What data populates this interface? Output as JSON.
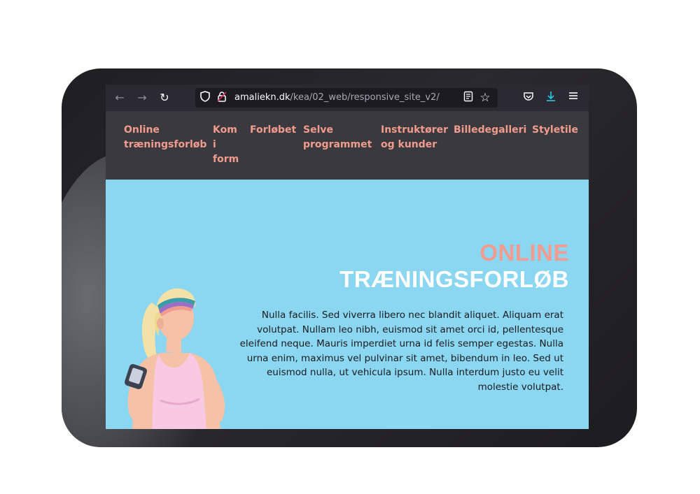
{
  "browser": {
    "url_domain": "amaliekn.dk",
    "url_path": "/kea/02_web/responsive_site_v2/",
    "icons": {
      "back": "arrow-left-icon",
      "forward": "arrow-right-icon",
      "reload": "reload-icon",
      "shield": "tracking-shield-icon",
      "lock": "insecure-lock-icon",
      "reader": "reader-view-icon",
      "bookmark": "star-icon",
      "pocket": "pocket-icon",
      "downloads": "download-icon",
      "menu": "hamburger-menu-icon"
    }
  },
  "site_nav": {
    "items": [
      {
        "label": "Online\ntræningsforløb"
      },
      {
        "label": "Kom\ni\nform"
      },
      {
        "label": "Forløbet"
      },
      {
        "label": "Selve\nprogrammet"
      },
      {
        "label": "Instruktører\nog kunder"
      },
      {
        "label": "Billedegalleri"
      },
      {
        "label": "Styletile"
      }
    ]
  },
  "hero": {
    "title_line1": "ONLINE",
    "title_line2": "TRÆNINGSFORLØB",
    "body": "Nulla facilis. Sed viverra libero nec blandit aliquet. Aliquam erat volutpat. Nullam leo nibh, euismod sit amet orci id, pellentesque eleifend neque. Mauris imperdiet urna id felis semper egestas. Nulla urna enim, maximus vel pulvinar sit amet, bibendum in leo. Sed ut euismod nulla, ut vehicula ipsum. Nulla interdum justo eu velit molestie volutpat."
  },
  "colors": {
    "accent": "#f19c8f",
    "hero_background": "#8bd6f1",
    "nav_background": "#3a393d",
    "browser_background": "#2b2a33"
  }
}
